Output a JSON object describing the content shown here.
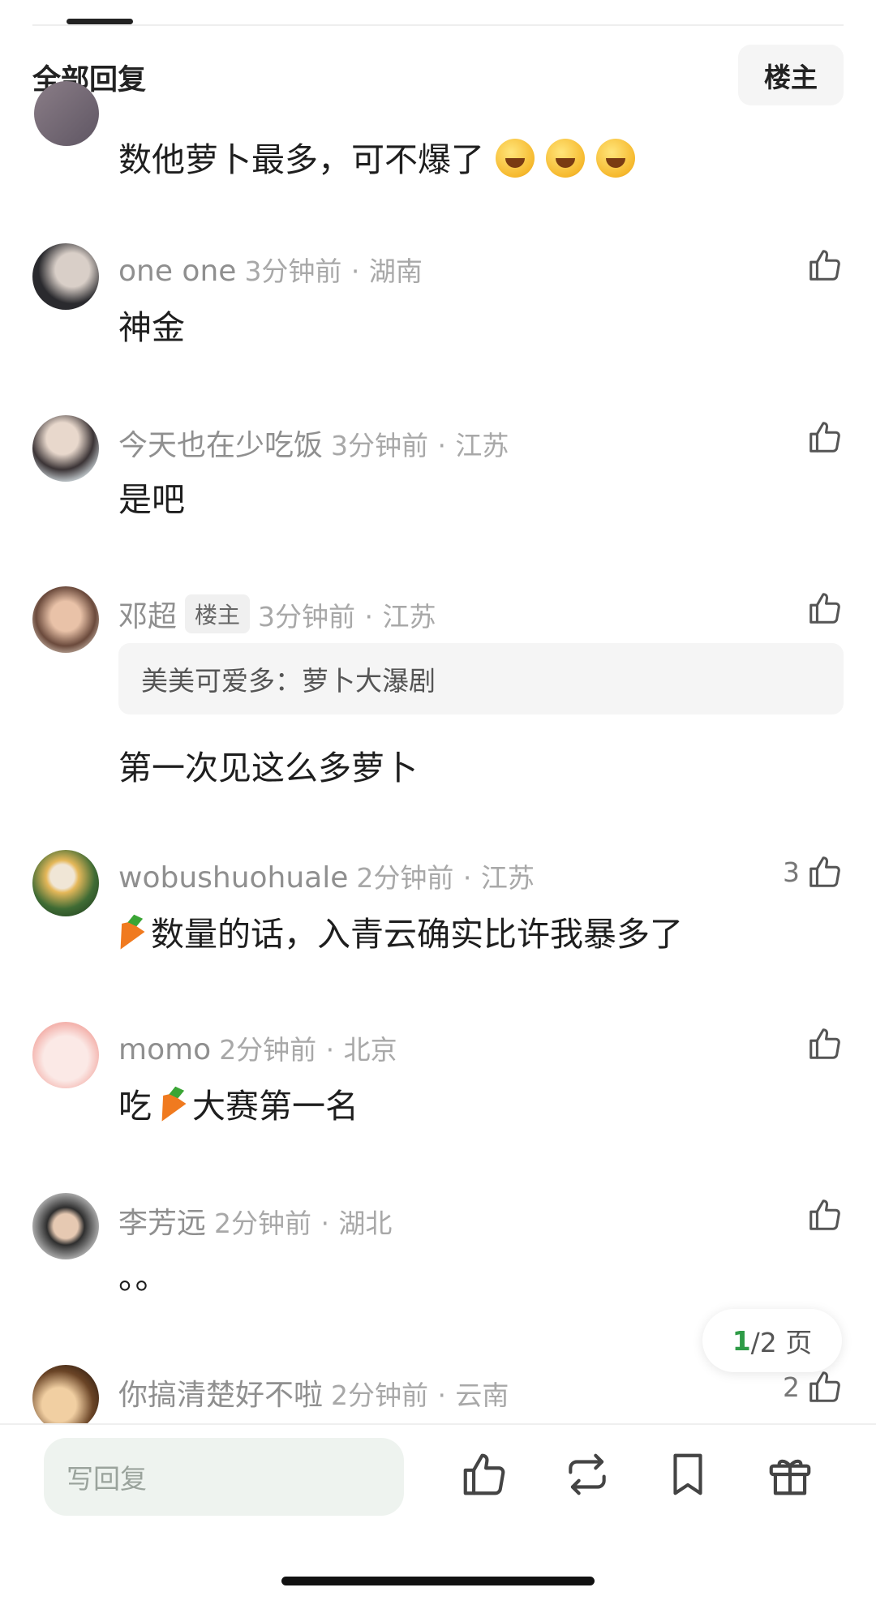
{
  "header": {
    "title": "全部回复",
    "owner_button": "楼主"
  },
  "previous_comment": {
    "text": "数他萝卜最多，可不爆了"
  },
  "comments": [
    {
      "username": "one one",
      "time": "3分钟前",
      "location": "湖南",
      "text": "神金",
      "likes": ""
    },
    {
      "username": "今天也在少吃饭",
      "time": "3分钟前",
      "location": "江苏",
      "text": "是吧",
      "likes": ""
    },
    {
      "username": "邓超",
      "badge": "楼主",
      "time": "3分钟前",
      "location": "江苏",
      "quote": "美美可爱多：萝卜大瀑剧",
      "text": "第一次见这么多萝卜",
      "likes": ""
    },
    {
      "username": "wobushuohuale",
      "time": "2分钟前",
      "location": "江苏",
      "text": "数量的话，入青云确实比许我暴多了",
      "likes": "3"
    },
    {
      "username": "momo",
      "time": "2分钟前",
      "location": "北京",
      "text_prefix": "吃",
      "text": "大赛第一名",
      "likes": ""
    },
    {
      "username": "李芳远",
      "time": "2分钟前",
      "location": "湖北",
      "text": "。。",
      "likes": ""
    },
    {
      "username": "你搞清楚好不啦",
      "time": "2分钟前",
      "location": "云南",
      "text": "",
      "likes": "2"
    }
  ],
  "separator": "·",
  "pagination": {
    "current": "1",
    "rest": "/2 页"
  },
  "bottom_bar": {
    "reply_placeholder": "写回复"
  },
  "icons": [
    "thumbs-up-icon",
    "repost-icon",
    "bookmark-icon",
    "gift-icon"
  ],
  "colors": {
    "accent_green": "#2e9b47",
    "reply_box": "#eef3ef",
    "meta_gray": "#a8a8a8"
  }
}
